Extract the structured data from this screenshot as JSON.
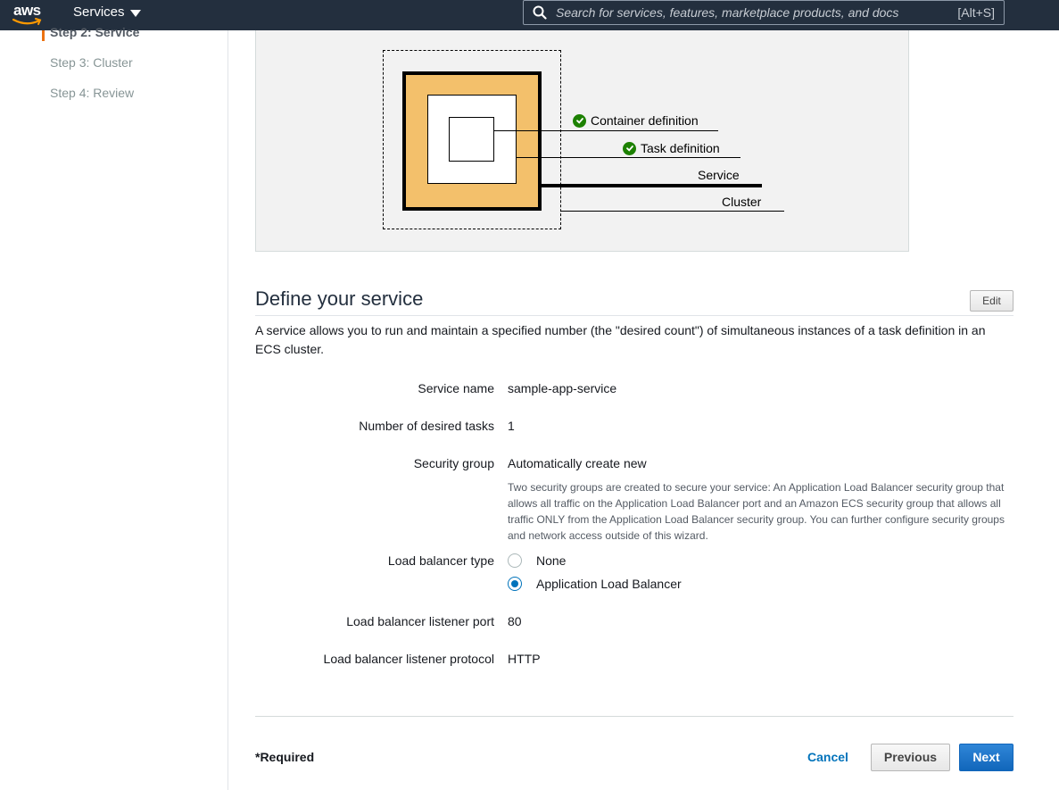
{
  "topnav": {
    "logo_text": "aws",
    "services_label": "Services",
    "search_placeholder": "Search for services, features, marketplace products, and docs",
    "search_shortcut": "[Alt+S]"
  },
  "sidebar": {
    "steps": [
      {
        "label": "Step 2: Service",
        "active": true
      },
      {
        "label": "Step 3: Cluster",
        "active": false
      },
      {
        "label": "Step 4: Review",
        "active": false
      }
    ]
  },
  "diagram": {
    "labels": {
      "container_definition": "Container definition",
      "task_definition": "Task definition",
      "service": "Service",
      "cluster": "Cluster"
    },
    "colors": {
      "service_box": "#f3c06b",
      "check": "#1d8102"
    }
  },
  "section": {
    "title": "Define your service",
    "edit_label": "Edit",
    "description": "A service allows you to run and maintain a specified number (the \"desired count\") of simultaneous instances of a task definition in an ECS cluster."
  },
  "fields": {
    "service_name": {
      "label": "Service name",
      "value": "sample-app-service"
    },
    "desired_tasks": {
      "label": "Number of desired tasks",
      "value": "1"
    },
    "security_group": {
      "label": "Security group",
      "value": "Automatically create new",
      "help": "Two security groups are created to secure your service: An Application Load Balancer security group that allows all traffic on the Application Load Balancer port and an Amazon ECS security group that allows all traffic ONLY from the Application Load Balancer security group. You can further configure security groups and network access outside of this wizard."
    },
    "lb_type": {
      "label": "Load balancer type",
      "options": [
        {
          "label": "None",
          "selected": false
        },
        {
          "label": "Application Load Balancer",
          "selected": true
        }
      ]
    },
    "listener_port": {
      "label": "Load balancer listener port",
      "value": "80"
    },
    "listener_protocol": {
      "label": "Load balancer listener protocol",
      "value": "HTTP"
    }
  },
  "footer": {
    "required_label": "*Required",
    "cancel_label": "Cancel",
    "previous_label": "Previous",
    "next_label": "Next"
  },
  "colors": {
    "nav_bg": "#232f3e",
    "accent": "#ec7211",
    "link": "#0073bb",
    "primary": "#1166bb"
  }
}
